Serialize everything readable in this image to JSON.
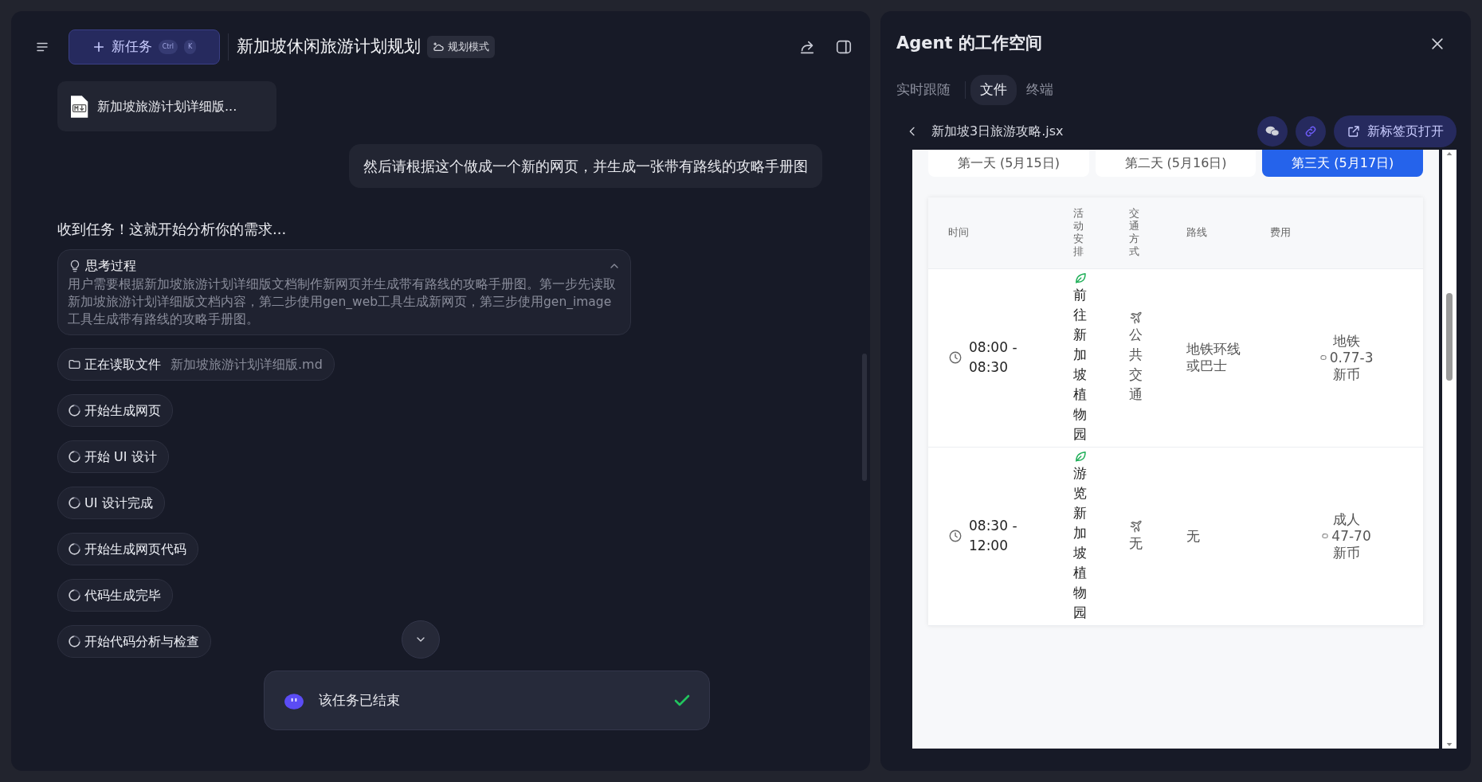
{
  "header": {
    "title": "新加坡休闲旅游计划规划",
    "new_task": {
      "label": "新任务",
      "keys": [
        "Ctrl",
        "K"
      ]
    },
    "mode_badge": "规划模式"
  },
  "chat": {
    "attachment": "新加坡旅游计划详细版...",
    "user_message": "然后请根据这个做成一个新的网页，并生成一张带有路线的攻略手册图",
    "reply": "收到任务！这就开始分析你的需求...",
    "thinking": {
      "title": "思考过程",
      "expanded": true,
      "text": "用户需要根据新加坡旅游计划详细版文档制作新网页并生成带有路线的攻略手册图。第一步先读取新加坡旅游计划详细版文档内容，第二步使用gen_web工具生成新网页，第三步使用gen_image工具生成带有路线的攻略手册图。"
    },
    "steps": [
      {
        "kind": "file",
        "label": "正在读取文件",
        "detail": "新加坡旅游计划详细版.md"
      },
      {
        "kind": "progress",
        "label": "开始生成网页"
      },
      {
        "kind": "progress",
        "label": "开始 UI 设计"
      },
      {
        "kind": "progress",
        "label": "UI 设计完成"
      },
      {
        "kind": "progress",
        "label": "开始生成网页代码"
      },
      {
        "kind": "progress",
        "label": "代码生成完毕"
      },
      {
        "kind": "progress",
        "label": "开始代码分析与检查"
      }
    ],
    "status": {
      "text": "该任务已结束",
      "done": true
    }
  },
  "workspace": {
    "title": "Agent 的工作空间",
    "tabs": [
      {
        "label": "实时跟随",
        "selected": false
      },
      {
        "label": "文件",
        "selected": true
      },
      {
        "label": "终端",
        "selected": false
      }
    ],
    "file": {
      "name": "新加坡3日旅游攻略.jsx",
      "open_button": "新标签页打开"
    },
    "preview": {
      "days": [
        {
          "label": "第一天 (5月15日)",
          "selected": false
        },
        {
          "label": "第二天 (5月16日)",
          "selected": false
        },
        {
          "label": "第三天 (5月17日)",
          "selected": true
        }
      ],
      "columns": [
        "时间",
        "活动安排",
        "交通方式",
        "路线",
        "费用"
      ],
      "rows": [
        {
          "time": "08:00 - 08:30",
          "activity": "前往新加坡植物园",
          "transport": "公共交通",
          "route": "地铁环线或巴士",
          "cost": {
            "label": "地铁",
            "amount": "0.77-3",
            "unit": "新币"
          }
        },
        {
          "time": "08:30 - 12:00",
          "activity": "游览新加坡植物园",
          "transport": "无",
          "route": "无",
          "cost": {
            "label": "成人",
            "amount": "47-70",
            "unit": "新币"
          }
        }
      ]
    }
  }
}
